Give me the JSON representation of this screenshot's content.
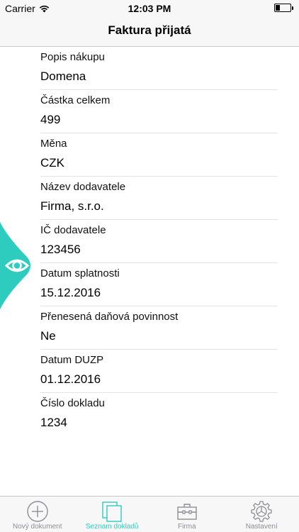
{
  "status": {
    "carrier": "Carrier",
    "time": "12:03 PM",
    "battery_level": 0.3
  },
  "nav": {
    "title": "Faktura přijatá"
  },
  "fields": [
    {
      "label": "Popis nákupu",
      "value": "Domena"
    },
    {
      "label": "Částka celkem",
      "value": "499"
    },
    {
      "label": "Měna",
      "value": "CZK"
    },
    {
      "label": "Název dodavatele",
      "value": "Firma, s.r.o."
    },
    {
      "label": "IČ dodavatele",
      "value": "123456"
    },
    {
      "label": "Datum splatnosti",
      "value": "15.12.2016"
    },
    {
      "label": "Přenesená daňová povinnost",
      "value": "Ne"
    },
    {
      "label": "Datum DUZP",
      "value": "01.12.2016"
    },
    {
      "label": "Číslo dokladu",
      "value": "1234"
    }
  ],
  "eye_tab": {
    "icon": "eye-icon",
    "color": "#2ecbbf"
  },
  "tabs": [
    {
      "label": "Nový dokument",
      "icon": "plus-circle-icon",
      "active": false
    },
    {
      "label": "Seznam dokladů",
      "icon": "documents-icon",
      "active": true
    },
    {
      "label": "Firma",
      "icon": "briefcase-icon",
      "active": false
    },
    {
      "label": "Nastavení",
      "icon": "gear-icon",
      "active": false
    }
  ],
  "colors": {
    "accent": "#2ecbbf",
    "inactive": "#8e8e93"
  }
}
